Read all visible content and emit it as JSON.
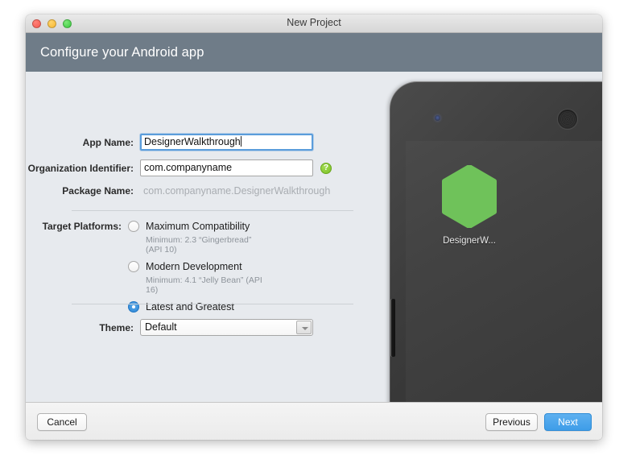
{
  "window": {
    "title": "New Project",
    "traffic_lights": [
      "close",
      "minimize",
      "maximize"
    ]
  },
  "banner": {
    "title": "Configure your Android app"
  },
  "form": {
    "app_name": {
      "label": "App Name:",
      "value": "DesignerWalkthrough",
      "placeholder": "App Name",
      "focused": true
    },
    "organization_identifier": {
      "label": "Organization Identifier:",
      "value": "com.companyname",
      "placeholder": "com.companyname",
      "help": "?"
    },
    "package_name": {
      "label": "Package Name:",
      "value": "com.companyname.DesignerWalkthrough"
    },
    "target_platforms": {
      "label": "Target Platforms:",
      "options": [
        {
          "title": "Maximum Compatibility",
          "subtitle": "Minimum: 2.3 “Gingerbread” (API 10)",
          "selected": false
        },
        {
          "title": "Modern Development",
          "subtitle": "Minimum: 4.1 “Jelly Bean” (API 16)",
          "selected": false
        },
        {
          "title": "Latest and Greatest",
          "subtitle": "",
          "selected": true
        }
      ]
    },
    "theme": {
      "label": "Theme:",
      "value": "Default",
      "options": [
        "Default"
      ]
    }
  },
  "preview": {
    "app_icon_label": "DesignerW...",
    "icon_shape": "hexagon-icon",
    "icon_color": "#6fc25a",
    "device": "android-phone"
  },
  "footer": {
    "cancel_label": "Cancel",
    "previous_label": "Previous",
    "next_label": "Next"
  },
  "colors": {
    "banner_bg": "#6f7c88",
    "content_bg": "#e7eaee",
    "accent_blue": "#3e9de8",
    "focus_blue": "#5b9ddb",
    "help_green": "#7cc023",
    "icon_green": "#6fc25a"
  }
}
